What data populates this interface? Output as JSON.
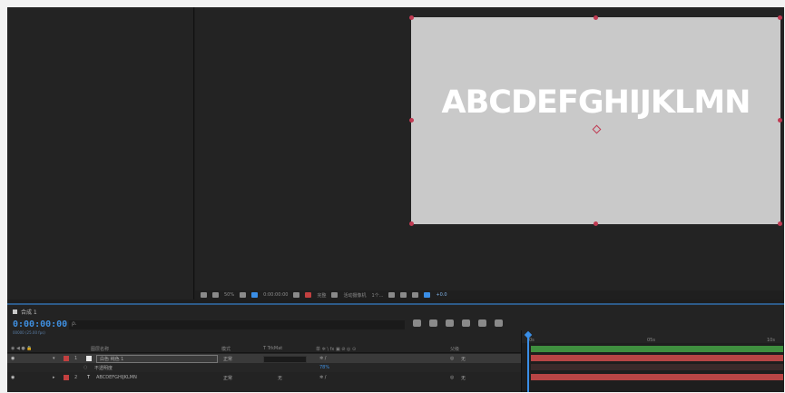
{
  "canvas": {
    "text": "ABCDEFGHIJKLMN"
  },
  "viewer_toolbar": {
    "zoom": "50%",
    "timecode": "0:00:00:00",
    "resolution": "完整",
    "camera": "活动摄像机",
    "views": "1个...",
    "exposure": "+0.0"
  },
  "timeline": {
    "tab_label": "合成 1",
    "current_time": "0:00:00:00",
    "frame_info": "00000 (25.00 fps)",
    "search_placeholder": "ρ.",
    "columns": {
      "layer_name": "图层名称",
      "mode": "模式",
      "trkmat": "T TrkMat",
      "switches": "单 ✲ \\ fx ▣ ⊘ ◎ ⊙",
      "parent": "父级"
    },
    "layers": [
      {
        "index": "1",
        "type_icon": "■",
        "name": "白色 纯色 1",
        "mode": "正常",
        "trkmat": "",
        "parent": "无",
        "color": "#c8c8c8"
      },
      {
        "index": "",
        "type_icon": "◌",
        "name": "不透明度",
        "mode": "",
        "trkmat": "",
        "value": "78%",
        "parent": "",
        "color": ""
      },
      {
        "index": "2",
        "type_icon": "T",
        "name": "ABCDEFGHIJKLMN",
        "mode": "正常",
        "trkmat": "无",
        "parent": "无",
        "color": "#c24040"
      }
    ],
    "ruler_labels": [
      "0s",
      "05s",
      "10s"
    ]
  },
  "colors": {
    "accent": "#3a8ee6",
    "layer_bar_green": "#3f8f3f",
    "layer_bar_red": "#b84545",
    "handle": "#c03a52"
  }
}
